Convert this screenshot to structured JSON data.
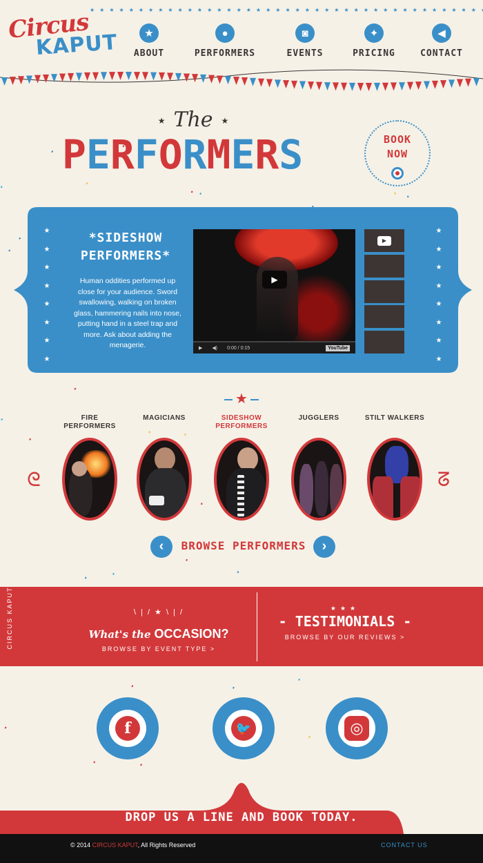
{
  "brand": {
    "line1": "Circus",
    "line2": "KAPUT"
  },
  "nav": [
    {
      "label": "ABOUT",
      "icon": "star-icon"
    },
    {
      "label": "PERFORMERS",
      "icon": "person-icon"
    },
    {
      "label": "EVENTS",
      "icon": "camera-icon"
    },
    {
      "label": "PRICING",
      "icon": "magic-wand-icon"
    },
    {
      "label": "CONTACT",
      "icon": "megaphone-icon"
    }
  ],
  "hero": {
    "the": "The",
    "title": "PERFORMERS",
    "book_line1": "BOOK",
    "book_line2": "NOW"
  },
  "feature": {
    "title_line1": "*SIDESHOW",
    "title_line2": "PERFORMERS*",
    "description": "Human oddities performed up close for your audience. Sword swallowing, walking on broken glass, hammering nails into nose, putting hand in a steel trap and more.  Ask about adding the menagerie.",
    "video_time": "0:00 / 0:15",
    "video_brand": "YouTube"
  },
  "performers": [
    {
      "label": "FIRE PERFORMERS",
      "active": false
    },
    {
      "label": "MAGICIANS",
      "active": false
    },
    {
      "label": "SIDESHOW PERFORMERS",
      "active": true
    },
    {
      "label": "JUGGLERS",
      "active": false
    },
    {
      "label": "STILT WALKERS",
      "active": false
    }
  ],
  "browse": {
    "label": "BROWSE PERFORMERS"
  },
  "band": {
    "vertical_brand": "CIRCUS KAPUT",
    "occasion_prefix": "What's the",
    "occasion_word": "OCCASION?",
    "occasion_sub": "BROWSE BY EVENT TYPE >",
    "testimonials": "TESTIMONIALS",
    "testimonials_sub": "BROWSE BY OUR REVIEWS >"
  },
  "social": [
    {
      "icon": "facebook-icon",
      "glyph": "f"
    },
    {
      "icon": "twitter-icon",
      "glyph": "🐦"
    },
    {
      "icon": "instagram-icon",
      "glyph": "◎"
    }
  ],
  "cta": "DROP US A LINE AND BOOK TODAY.",
  "footer": {
    "copy_prefix": "© 2014 ",
    "copy_brand": "CIRCUS KAPUT",
    "copy_suffix": ", All Rights Reserved",
    "contact": "CONTACT US"
  },
  "colors": {
    "red": "#d2383a",
    "blue": "#3a8fc8",
    "cream": "#f5f1e7",
    "dark": "#111111"
  }
}
